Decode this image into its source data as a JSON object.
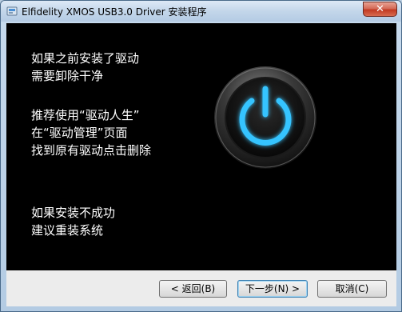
{
  "window": {
    "title": "Elfidelity XMOS USB3.0 Driver 安装程序",
    "close_label": "✕"
  },
  "messages": {
    "line1": "如果之前安装了驱动",
    "line2": "需要卸除干净",
    "line3": "推荐使用“驱动人生”",
    "line4": "在“驱动管理”页面",
    "line5": "找到原有驱动点击删除",
    "line6": "如果安装不成功",
    "line7": "建议重装系统"
  },
  "buttons": {
    "back": "< 返回(B)",
    "next": "下一步(N) >",
    "cancel": "取消(C)"
  },
  "icons": {
    "app": "installer-icon",
    "power": "power-icon",
    "close": "close-icon"
  },
  "colors": {
    "banner_bg": "#000000",
    "power_glow": "#35c4ff",
    "titlebar": "#c3d6ea",
    "close_red": "#c23a22"
  }
}
